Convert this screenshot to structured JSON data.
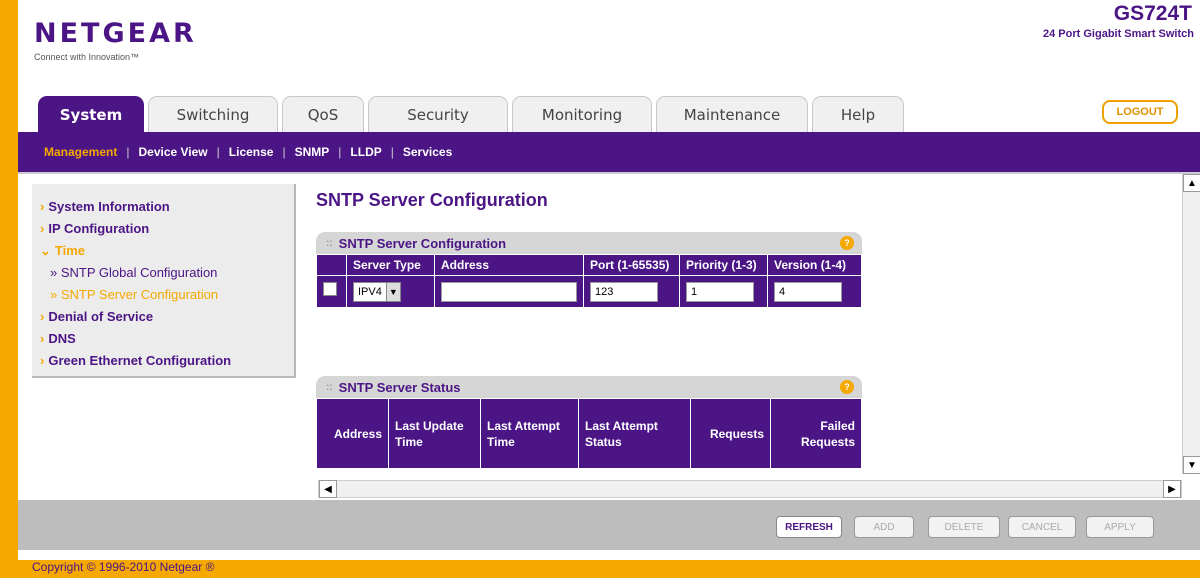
{
  "brand": {
    "logo": "NETGEAR",
    "tagline": "Connect with Innovation™",
    "model": "GS724T",
    "model_desc": "24 Port Gigabit Smart Switch"
  },
  "tabs": [
    "System",
    "Switching",
    "QoS",
    "Security",
    "Monitoring",
    "Maintenance",
    "Help"
  ],
  "logout": "LOGOUT",
  "subnav": [
    "Management",
    "Device View",
    "License",
    "SNMP",
    "LLDP",
    "Services"
  ],
  "sidebar": {
    "items": [
      "System Information",
      "IP Configuration",
      "Time",
      "SNTP Global Configuration",
      "SNTP Server Configuration",
      "Denial of Service",
      "DNS",
      "Green Ethernet Configuration"
    ]
  },
  "page_title": "SNTP Server Configuration",
  "config_panel": {
    "title": "SNTP Server Configuration",
    "headers": {
      "server_type": "Server Type",
      "address": "Address",
      "port": "Port (1-65535)",
      "priority": "Priority (1-3)",
      "version": "Version (1-4)"
    },
    "row": {
      "server_type": "IPV4",
      "address": "",
      "port": "123",
      "priority": "1",
      "version": "4"
    }
  },
  "status_panel": {
    "title": "SNTP Server Status",
    "headers": [
      "Address",
      "Last Update Time",
      "Last Attempt Time",
      "Last Attempt Status",
      "Requests",
      "Failed Requests"
    ]
  },
  "buttons": [
    "REFRESH",
    "ADD",
    "DELETE",
    "CANCEL",
    "APPLY"
  ],
  "copyright": "Copyright © 1996-2010 Netgear ®",
  "help_icon": "?",
  "colors": {
    "brand_purple": "#4b1585",
    "accent_orange": "#f5a800"
  }
}
